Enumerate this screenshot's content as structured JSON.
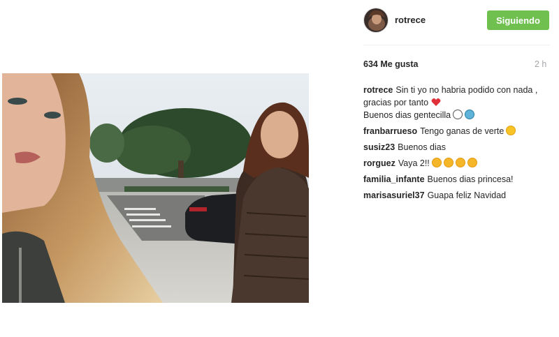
{
  "post": {
    "username": "rotrece",
    "follow_label": "Siguiendo",
    "likes": "634 Me gusta",
    "time": "2 h"
  },
  "comments": [
    {
      "user": "rotrece",
      "text": "Sin ti yo no habria podido con nada , gracias por tanto",
      "text2": "Buenos dias gentecilla",
      "emojis": [
        "heart-icon",
        "snowman-icon",
        "snowflake-icon"
      ]
    },
    {
      "user": "franbarrueso",
      "text": "Tengo ganas de verte",
      "emojis": [
        "tongue-face-icon"
      ]
    },
    {
      "user": "susiz23",
      "text": "Buenos dias",
      "emojis": []
    },
    {
      "user": "rorguez",
      "text": "Vaya 2!!",
      "emojis": [
        "heart-eyes-icon",
        "heart-eyes-icon",
        "heart-eyes-icon",
        "heart-eyes-icon"
      ]
    },
    {
      "user": "familia_infante",
      "text": "Buenos dias princesa!",
      "emojis": []
    },
    {
      "user": "marisasuriel37",
      "text": "Guapa feliz Navidad",
      "emojis": []
    }
  ],
  "colors": {
    "follow_button": "#70c050",
    "time_text": "#a5a7aa",
    "divider": "#efefef"
  }
}
